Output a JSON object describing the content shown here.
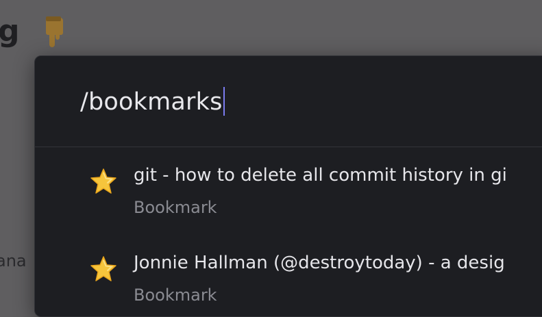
{
  "background": {
    "heading_fragment": "g",
    "emoji_icon": "pointing-down-hand-emoji",
    "side_text": "ana"
  },
  "palette": {
    "search": {
      "value": "/bookmarks"
    },
    "results": [
      {
        "icon": "star-icon",
        "title": "git - how to delete all commit history in gi",
        "subtitle": "Bookmark"
      },
      {
        "icon": "star-icon",
        "title": "Jonnie Hallman (@destroytoday) - a desig",
        "subtitle": "Bookmark"
      }
    ]
  },
  "colors": {
    "palette_bg": "#1d1e22",
    "caret": "#7b7cf0",
    "overlay": "#5f5e60"
  }
}
